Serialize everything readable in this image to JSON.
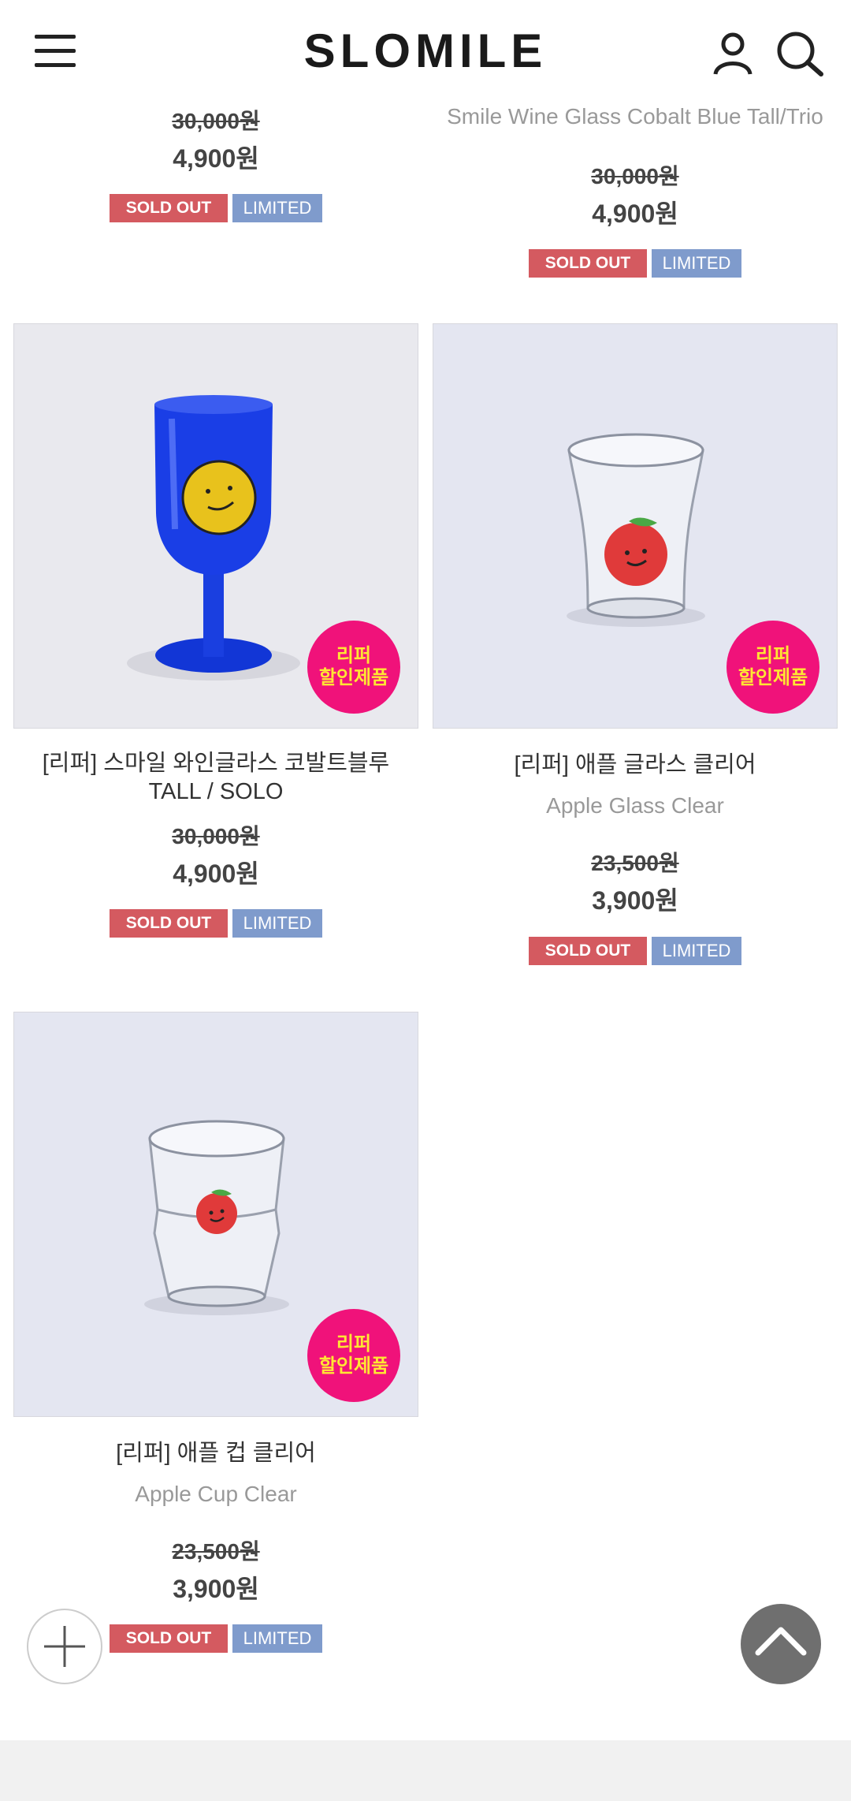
{
  "header": {
    "logo": "SLOMILE",
    "icons": [
      "menu-icon",
      "user-icon",
      "search-icon"
    ]
  },
  "products": [
    {
      "name_ko": "",
      "name_en": "",
      "price_old": "30,000원",
      "price_new": "4,900원",
      "tags": [
        "SOLD OUT",
        "LIMITED"
      ]
    },
    {
      "name_ko": "",
      "name_en": "Smile Wine Glass Cobalt Blue Tall/Trio",
      "price_old": "30,000원",
      "price_new": "4,900원",
      "tags": [
        "SOLD OUT",
        "LIMITED"
      ]
    },
    {
      "name_ko_line1": "[리퍼] 스마일 와인글라스 코발트블루",
      "name_ko_line2": "TALL / SOLO",
      "name_en": "",
      "price_old": "30,000원",
      "price_new": "4,900원",
      "badge_line1": "리퍼",
      "badge_line2": "할인제품",
      "tags": [
        "SOLD OUT",
        "LIMITED"
      ]
    },
    {
      "name_ko": "[리퍼] 애플 글라스 클리어",
      "name_en": "Apple Glass Clear",
      "price_old": "23,500원",
      "price_new": "3,900원",
      "badge_line1": "리퍼",
      "badge_line2": "할인제품",
      "tags": [
        "SOLD OUT",
        "LIMITED"
      ]
    },
    {
      "name_ko": "[리퍼] 애플 컵 클리어",
      "name_en": "Apple Cup Clear",
      "price_old": "23,500원",
      "price_new": "3,900원",
      "badge_line1": "리퍼",
      "badge_line2": "할인제품",
      "tags": [
        "SOLD OUT",
        "LIMITED"
      ]
    }
  ],
  "colors": {
    "sale_badge": "#f0127a",
    "sale_badge_text": "#ffe633",
    "sold_out": "#d45a60",
    "limited": "#7f9bcc"
  }
}
